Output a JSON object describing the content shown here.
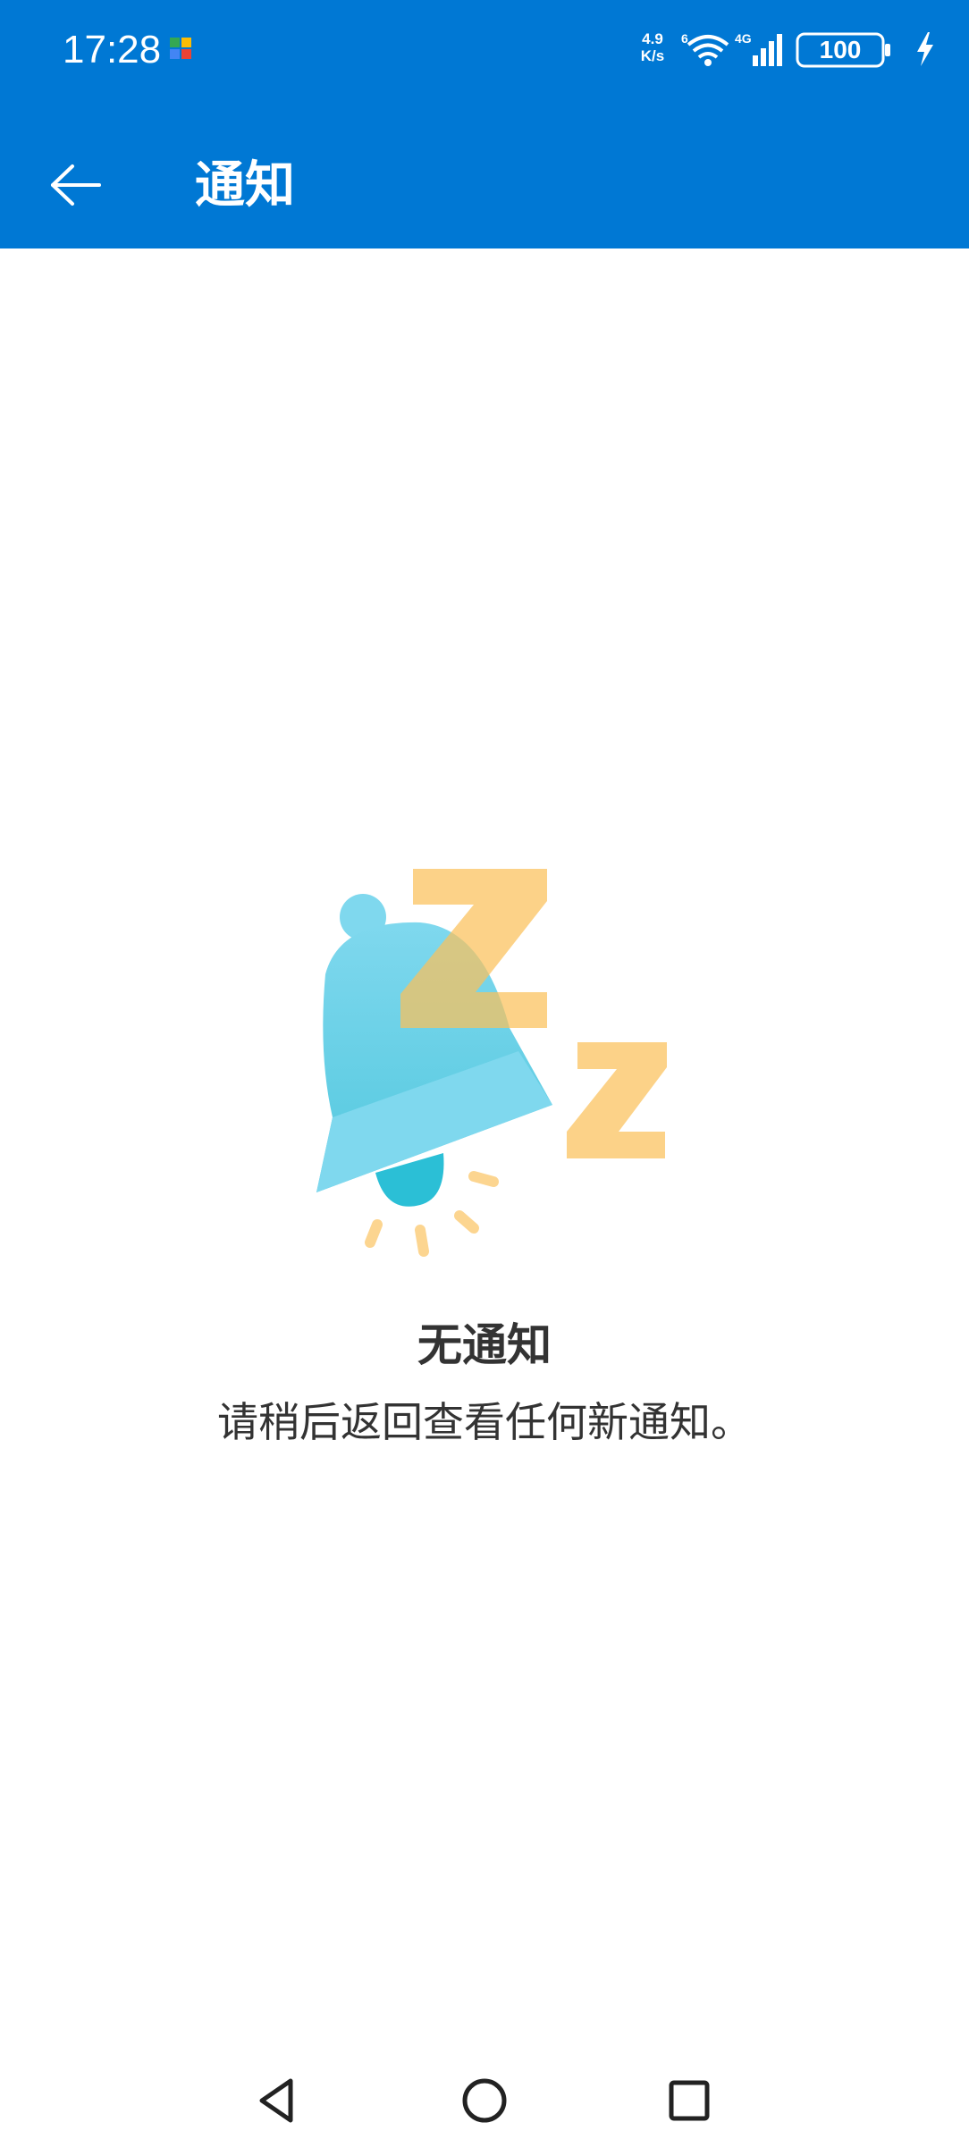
{
  "status_bar": {
    "time": "17:28",
    "net_speed_value": "4.9",
    "net_speed_unit": "K/s",
    "wifi_label": "6",
    "signal_label": "4G",
    "battery": "100"
  },
  "app_bar": {
    "title": "通知",
    "back_icon": "arrow-left-icon"
  },
  "empty_state": {
    "illustration": "sleeping-bell-icon",
    "title": "无通知",
    "subtitle": "请稍后返回查看任何新通知。"
  },
  "nav_bar": {
    "back_icon": "triangle-back-icon",
    "home_icon": "circle-home-icon",
    "recents_icon": "square-recents-icon"
  },
  "colors": {
    "primary": "#0078d4",
    "bell": "#7fd8ee",
    "bell_clapper": "#2bbfd6",
    "z_accent": "#fbc05a"
  }
}
